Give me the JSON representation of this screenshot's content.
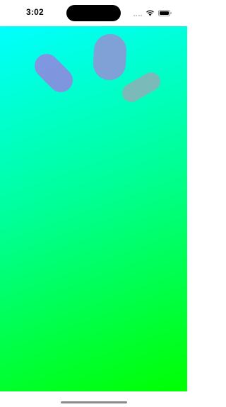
{
  "status_bar": {
    "time": "3:02",
    "icons": [
      "signal-dots-icon",
      "wifi-icon",
      "battery-icon"
    ]
  },
  "colors": {
    "gradient_top": "#00ffff",
    "gradient_bottom": "#00ff00",
    "blob_color": "#8a8ee0",
    "blob_light_color": "#90a8b0"
  }
}
